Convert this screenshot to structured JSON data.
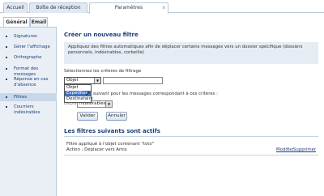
{
  "tabs": [
    {
      "label": "Accueil"
    },
    {
      "label": "Boîte de réception"
    },
    {
      "label": "Paramètres"
    }
  ],
  "close_glyph": "x",
  "subtabs": [
    {
      "label": "Général"
    },
    {
      "label": "Email"
    }
  ],
  "sidebar": {
    "items": [
      {
        "label": "Signatures"
      },
      {
        "label": "Gérer l'affichage"
      },
      {
        "label": "Orthographe"
      },
      {
        "label": "Format des messages"
      },
      {
        "label": "Réponse en cas d'absence"
      },
      {
        "label": "Filtres"
      },
      {
        "label": "Courriers indésirables"
      }
    ]
  },
  "main": {
    "title": "Créer un nouveau filtre",
    "info": "Appliquez des filtres automatiques afin de déplacer certains messages vers un dossier spécifique (dossiers personnels, indésirables, corbeille)",
    "criteria_label": "Sélectionnez les critères de filtrage",
    "criteria_select": {
      "value": "Objet",
      "options": [
        "Objet",
        "Expéditeur",
        "Destinataire"
      ],
      "highlighted": "Expéditeur"
    },
    "action_label": "suivant pour les messages correspondant à ces critères :",
    "action_prefix": "Déplacer vers",
    "action_select": "indésirables",
    "buttons": {
      "validate": "Valider",
      "cancel": "Annuler"
    },
    "active_title": "Les filtres suivants sont actifs",
    "filter_line1": "Filtre appliqué à l'objet contenant \"toto\"",
    "filter_line2": "Action : Déplacer vers Amis",
    "modify": "Modifier",
    "delete": "Supprimer"
  }
}
